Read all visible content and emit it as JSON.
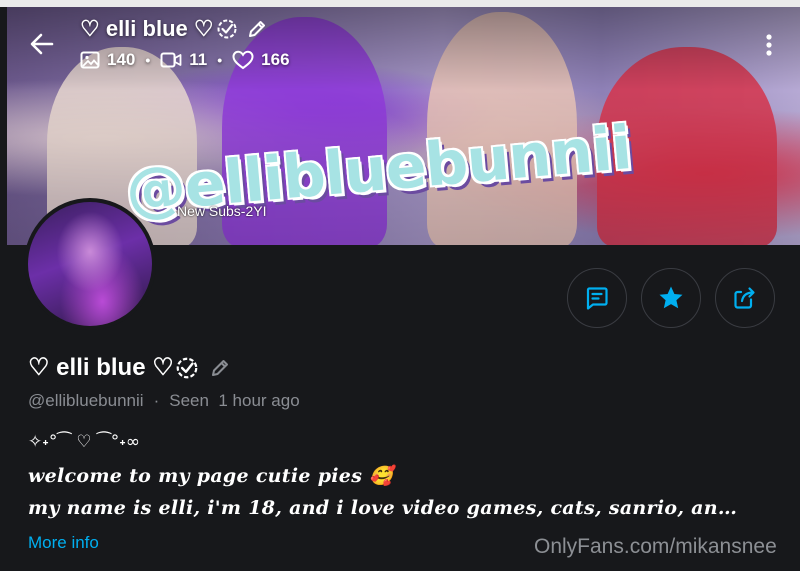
{
  "header": {
    "name": "♡ elli blue ♡",
    "stats": [
      {
        "icon": "image-icon",
        "value": "140"
      },
      {
        "icon": "video-icon",
        "value": "11"
      },
      {
        "icon": "heart-icon",
        "value": "166"
      }
    ]
  },
  "cover": {
    "brand_text": "@ellibluebunnii",
    "sub_text": "New Subs-2YI"
  },
  "actions": {
    "icons": [
      "message-icon",
      "star-icon",
      "share-icon"
    ]
  },
  "profile": {
    "name": "♡ elli blue ♡",
    "handle": "@ellibluebunnii",
    "separator": "·",
    "last_seen": "Seen  1 hour ago"
  },
  "bio": {
    "line1": "✧˖°⁀ ♡ ⁀°˖∞",
    "line2": "welcome to my page cutie pies 🥰",
    "line3": "my name is elli, i'm 18, and i love video games, cats, sanrio, an…"
  },
  "links": {
    "more_info": "More info"
  },
  "watermark": "OnlyFans.com/mikansnee",
  "colors": {
    "accent": "#00aff0",
    "background": "#17181b",
    "muted_text": "#8a8d93"
  }
}
